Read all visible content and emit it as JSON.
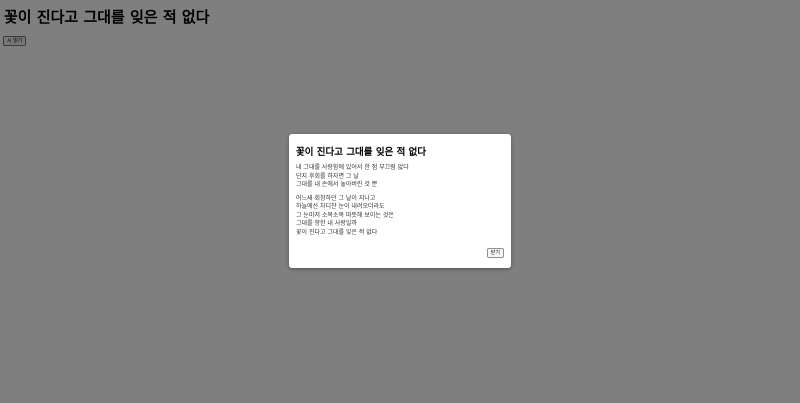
{
  "page": {
    "title": "꽃이 진다고 그대를 잊은 적 없다",
    "read_button_label": "시 읽기"
  },
  "modal": {
    "title": "꽃이 진다고 그대를 잊은 적 없다",
    "stanzas": [
      {
        "lines": [
          "내 그대를 사랑함에 있어서 한 점 부끄럼 없다",
          "단지 후회를 하자면 그 날",
          "그대를 내 손에서 놓아버린 것 뿐"
        ]
      },
      {
        "lines": [
          "어느새 회창하던 그 날이 지나고",
          "하늘에선 차디찬 눈이 내려오더라도",
          "그 눈마저 소복소복 따뜻해 보이는 것은",
          "그대를 향한 내 사랑일까",
          "꽃이 진다고 그대를 잊은 적 없다"
        ]
      }
    ],
    "close_button_label": "닫기"
  },
  "colors": {
    "overlay": "rgba(0,0,0,0.5)",
    "modal_background": "#ffffff",
    "text": "#333333"
  }
}
